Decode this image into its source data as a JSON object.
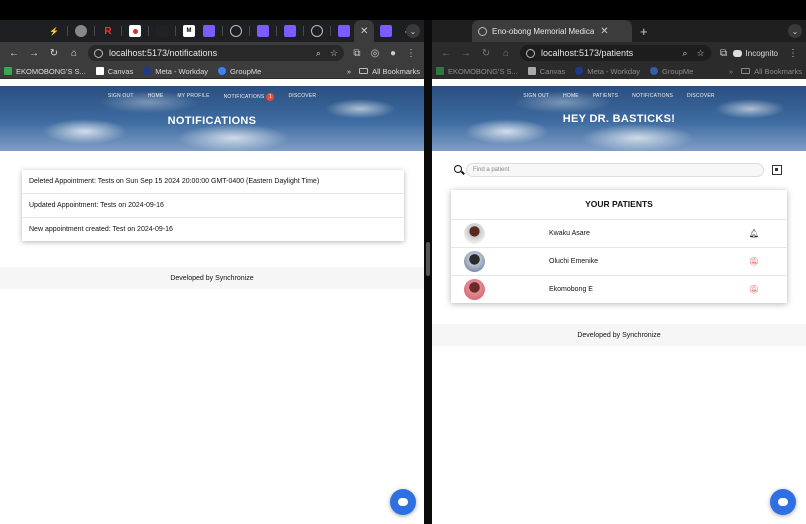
{
  "left_window": {
    "active_tab_icon": "close-icon",
    "url": "localhost:5173/notifications",
    "bookmarks": [
      {
        "label": "EKOMOBONG'S S...",
        "color": "#34a853"
      },
      {
        "label": "Canvas",
        "color": "#ffffff"
      },
      {
        "label": "Meta - Workday",
        "color": "#1a3a8f"
      },
      {
        "label": "GroupMe",
        "color": "#3b82f6"
      }
    ],
    "all_bookmarks": "All Bookmarks",
    "nav": [
      "SIGN OUT",
      "HOME",
      "MY PROFILE",
      "NOTIFICATIONS",
      "DISCOVER"
    ],
    "notification_badge": "1",
    "page_title": "NOTIFICATIONS",
    "notifications": [
      "Deleted Appointment: Tests on Sun Sep 15 2024 20:00:00 GMT-0400 (Eastern Daylight Time)",
      "Updated Appointment: Tests on 2024-09-16",
      "New appointment created: Test on 2024-09-16"
    ],
    "footer": "Developed by Synchronize"
  },
  "right_window": {
    "tab_title": "Eno-obong Memorial Medica",
    "url": "localhost:5173/patients",
    "incognito_label": "Incognito",
    "bookmarks": [
      {
        "label": "EKOMOBONG'S S...",
        "color": "#34a853"
      },
      {
        "label": "Canvas",
        "color": "#ffffff"
      },
      {
        "label": "Meta - Workday",
        "color": "#1a3a8f"
      },
      {
        "label": "GroupMe",
        "color": "#3b82f6"
      }
    ],
    "all_bookmarks": "All Bookmarks",
    "nav": [
      "SIGN OUT",
      "HOME",
      "PATIENTS",
      "NOTIFICATIONS",
      "DISCOVER"
    ],
    "page_title": "HEY DR. BASTICKS!",
    "search_placeholder": "Find a patient",
    "patients_title": "YOUR PATIENTS",
    "patients": [
      {
        "name": "Kwaku Asare",
        "notify": "on",
        "avatar_color": "#7a3b2e"
      },
      {
        "name": "Oluchi Emenike",
        "notify": "off",
        "avatar_color": "#5a6a85"
      },
      {
        "name": "Ekomobong E",
        "notify": "off",
        "avatar_color": "#d9707a"
      }
    ],
    "footer": "Developed by Synchronize"
  },
  "colors": {
    "accent_blue": "#2f6fe4",
    "alert_red": "#e44444",
    "badge_red": "#e14b3b"
  }
}
